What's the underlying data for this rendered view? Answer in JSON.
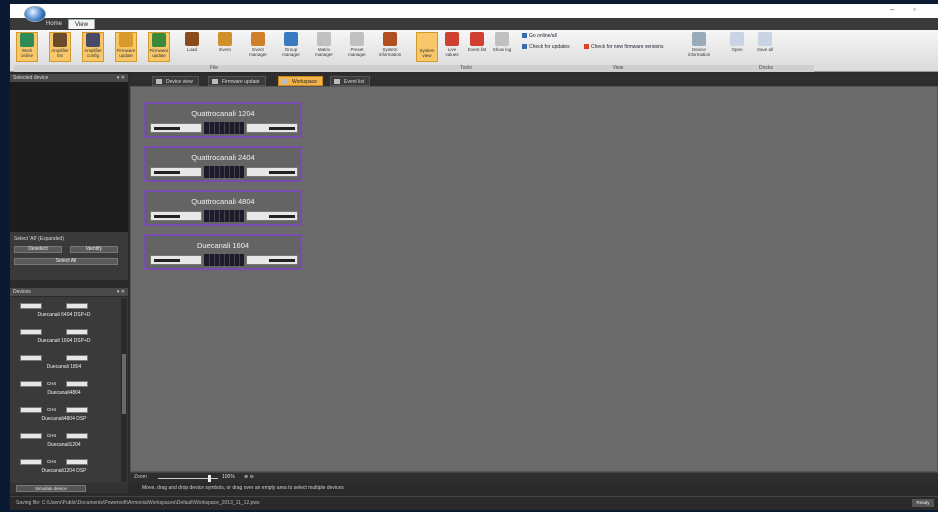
{
  "window": {
    "title": "",
    "min": "–",
    "max": "▫"
  },
  "ribbon_tabs": [
    "Home",
    "View"
  ],
  "ribbon": {
    "main_buttons": [
      {
        "label": "Work online",
        "icon": "globe-icon",
        "color": "#2e8b57"
      },
      {
        "label": "Amplifier list",
        "icon": "amp-list-icon",
        "color": "#6b4b2b"
      },
      {
        "label": "Amplifier config",
        "icon": "grid-icon",
        "color": "#4a4a6a"
      },
      {
        "label": "Firmware update",
        "icon": "firmware-icon",
        "color": "#d79a2b"
      },
      {
        "label": "Firmware update",
        "icon": "firmware-icon",
        "color": "#3a8a3a"
      },
      {
        "label": "Load",
        "icon": "load-icon",
        "color": "#8a4a1a"
      },
      {
        "label": "Event",
        "icon": "event-icon",
        "color": "#d0902a"
      },
      {
        "label": "Event manager",
        "icon": "event-manager-icon",
        "color": "#d0802a"
      },
      {
        "label": "Group manager",
        "icon": "group-icon",
        "color": "#3a7ac0"
      },
      {
        "label": "Matrix manager",
        "icon": "matrix-icon",
        "color": "#c0c0c0"
      },
      {
        "label": "Preset manager",
        "icon": "preset-icon",
        "color": "#c0c0c0"
      },
      {
        "label": "System information",
        "icon": "system-info-icon",
        "color": "#b05020"
      }
    ],
    "tools_buttons": [
      {
        "label": "System view",
        "icon": "system-view-icon",
        "color": "#f7c76a"
      },
      {
        "label": "Live values",
        "icon": "live-icon",
        "color": "#d04030"
      },
      {
        "label": "Event list",
        "icon": "event-list-icon",
        "color": "#d04030"
      },
      {
        "label": "Show log",
        "icon": "log-icon",
        "color": "#c0c0c0"
      }
    ],
    "small_buttons": [
      {
        "label": "Go online/all",
        "icon": "online-icon"
      },
      {
        "label": "Check for updates",
        "icon": "update-icon"
      },
      {
        "label": "Check for new firmware versions",
        "icon": "firmware-check-icon"
      }
    ],
    "right_buttons": [
      {
        "label": "Device information",
        "icon": "device-icon"
      },
      {
        "label": "Open",
        "icon": "open-icon"
      },
      {
        "label": "Save all",
        "icon": "save-icon"
      }
    ],
    "group_labels": [
      "File",
      "Tools",
      "View",
      "Docks"
    ]
  },
  "left_panel": {
    "preview_title": "Selected device",
    "select_label": "Select 'All' (Expanded)",
    "select_buttons": [
      "Deselect",
      "Identify",
      "Select All"
    ],
    "devices_title": "Devices",
    "devices": [
      {
        "name": "Duecanali 6404 DSP+D",
        "mid": ""
      },
      {
        "name": "Duecanali 1604 DSP+D",
        "mid": ""
      },
      {
        "name": "Duecanali 1804",
        "mid": ""
      },
      {
        "name": "Duecanali4804",
        "mid": "CH4"
      },
      {
        "name": "Duecanali4804 DSP",
        "mid": "CH4"
      },
      {
        "name": "Duecanali1204",
        "mid": "CH4"
      },
      {
        "name": "Duecanali1204 DSP",
        "mid": "CH4"
      }
    ],
    "footer_button": "Simulate device"
  },
  "doc_tabs": [
    "Device view",
    "Firmware update",
    "Workspace",
    "Event list"
  ],
  "active_doc_tab": 2,
  "amplifiers": [
    {
      "name": "Quattrocanali 1204"
    },
    {
      "name": "Quattrocanali 2404"
    },
    {
      "name": "Quattrocanali 4804"
    },
    {
      "name": "Duecanali 1604"
    }
  ],
  "zoom": {
    "label": "Zoom",
    "value": "100%",
    "level": 0.85
  },
  "hint_bar": "Move, drag and drop device symbols, or drag over an empty area to select multiple devices",
  "status_bar": "Saving file: C:\\Users\\Public\\Documents\\Powersoft\\Armonia\\Workspaces\\Default\\Workspace_2013_11_12.pws",
  "status_right": "Ready"
}
